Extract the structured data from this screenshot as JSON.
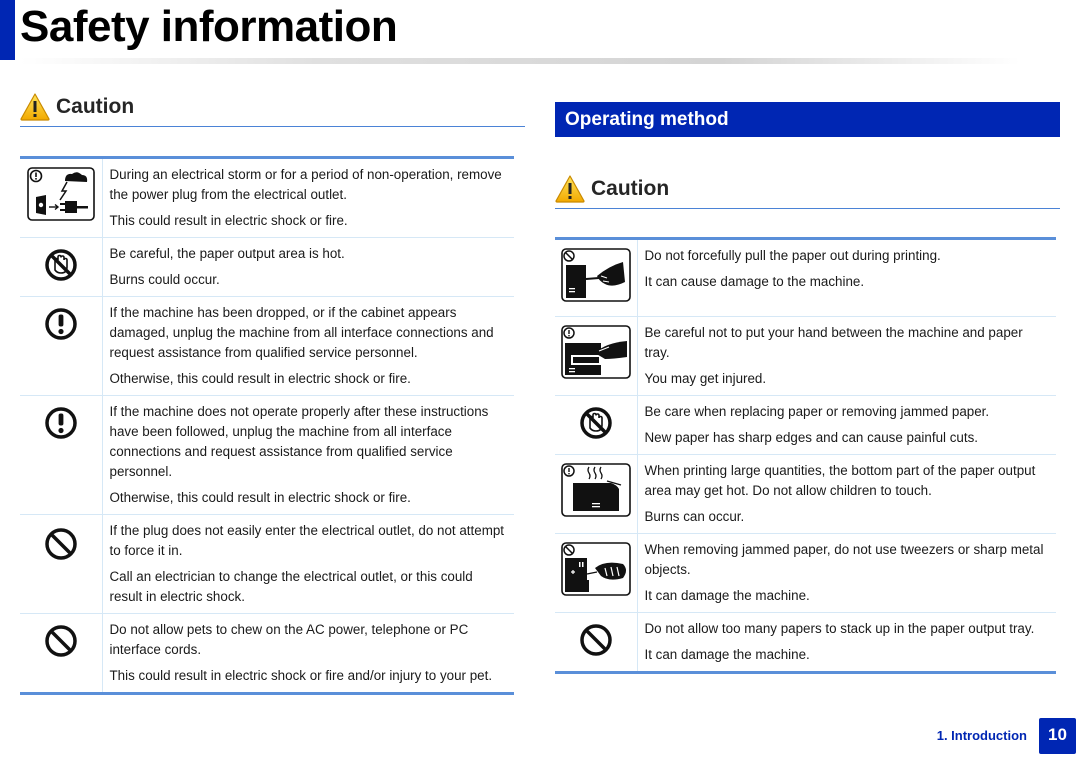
{
  "page": {
    "title": "Safety information",
    "accent_color": "#0026b3",
    "rule_color": "#5a8fd9"
  },
  "left": {
    "caution_label": "Caution",
    "items": [
      {
        "icon": "unplug-storm-icon",
        "main": "During an electrical storm or for a period of non-operation, remove the power plug from the electrical outlet.",
        "note": "This could result in electric shock or fire."
      },
      {
        "icon": "no-touch-hand-icon",
        "main": "Be careful, the paper output area is hot.",
        "note": "Burns could occur."
      },
      {
        "icon": "mandatory-icon",
        "main": "If the machine has been dropped, or if the cabinet appears damaged, unplug the machine from all interface connections and request assistance from qualified service personnel.",
        "note": "Otherwise, this could result in electric shock or fire."
      },
      {
        "icon": "mandatory-icon",
        "main": "If the machine does not operate properly after these instructions have been followed, unplug the machine from all interface connections and request assistance from qualified service personnel.",
        "note": "Otherwise, this could result in electric shock or fire."
      },
      {
        "icon": "prohibited-icon",
        "main": "If the plug does not easily enter the electrical outlet, do not attempt to force it in.",
        "note": "Call an electrician to change the electrical outlet, or this could result in electric shock."
      },
      {
        "icon": "prohibited-icon",
        "main": "Do not allow pets to chew on the AC power, telephone or PC interface cords.",
        "note": "This could result in electric shock or fire and/or injury to your pet."
      }
    ]
  },
  "right": {
    "section_title": "Operating method",
    "caution_label": "Caution",
    "items": [
      {
        "icon": "no-pull-paper-icon",
        "main": "Do not forcefully pull the paper out during printing.",
        "note": "It can cause damage to the machine."
      },
      {
        "icon": "hand-in-tray-icon",
        "main": "Be careful not to put your hand between the machine and paper tray.",
        "note": "You may get injured."
      },
      {
        "icon": "no-touch-hand-icon",
        "main": "Be care when replacing paper or removing jammed paper.",
        "note": "New paper has sharp edges and can cause painful cuts."
      },
      {
        "icon": "hot-output-icon",
        "main": "When printing large quantities, the bottom part of the paper output area may get hot. Do not allow children to touch.",
        "note": "Burns can occur."
      },
      {
        "icon": "no-tweezers-icon",
        "main": "When removing jammed paper, do not use tweezers or sharp metal objects.",
        "note": "It can damage the machine."
      },
      {
        "icon": "prohibited-icon",
        "main": "Do not allow too many papers to stack up in the paper output tray.",
        "note": "It can damage the machine."
      }
    ]
  },
  "footer": {
    "section": "1. Introduction",
    "page_number": "10"
  }
}
